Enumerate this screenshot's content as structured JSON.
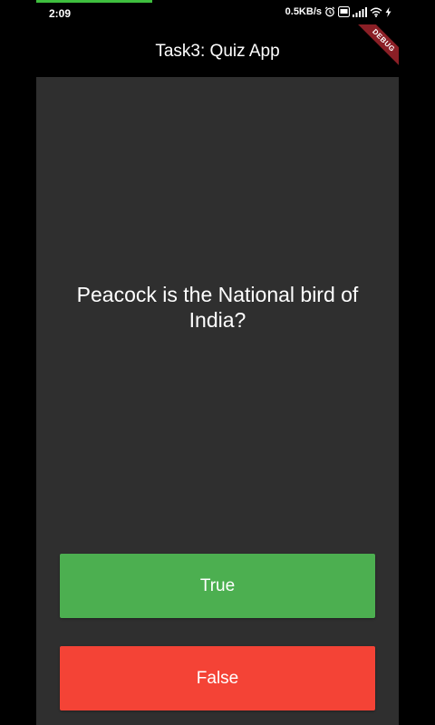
{
  "status_bar": {
    "time": "2:09",
    "network_speed": "0.5KB/s",
    "icons": [
      "alarm-icon",
      "vowifi-icon",
      "signal-icon",
      "wifi-icon",
      "charging-icon"
    ]
  },
  "app_bar": {
    "title": "Task3: Quiz App",
    "debug_banner": "DEBUG"
  },
  "quiz": {
    "question": "Peacock is the National bird of India?",
    "answers": {
      "true_label": "True",
      "false_label": "False"
    }
  },
  "colors": {
    "background": "#000000",
    "panel": "#2f2f2f",
    "true_button": "#4caf50",
    "false_button": "#f44336",
    "debug_banner": "#8b1f26",
    "progress_strip": "#3fbf3f"
  }
}
